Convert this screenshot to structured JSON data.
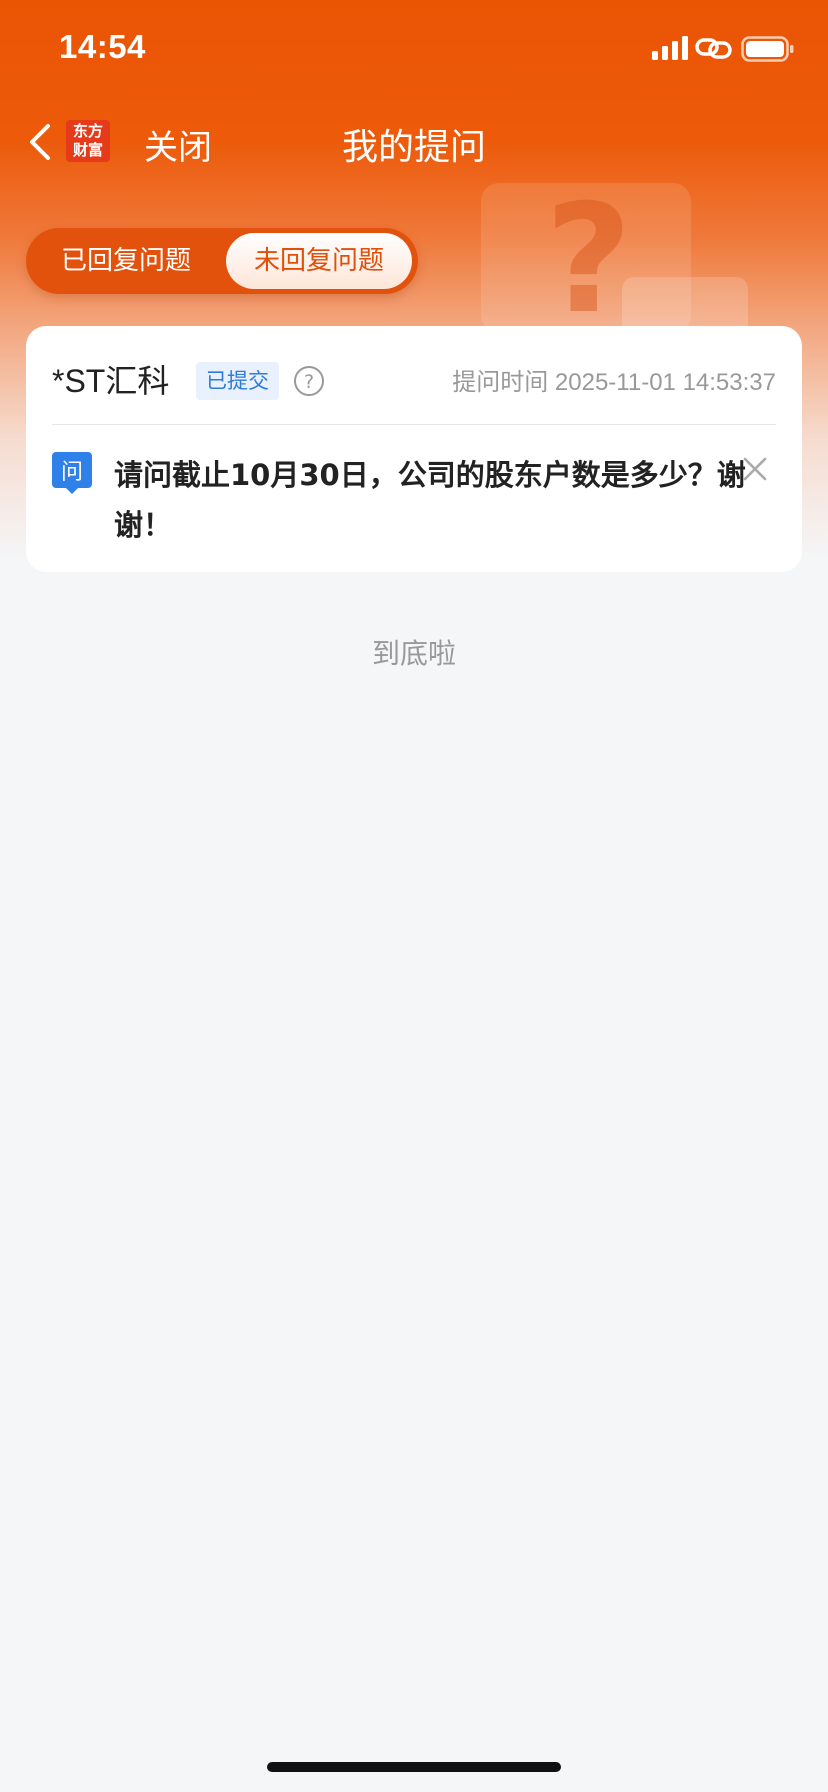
{
  "status_bar": {
    "time": "14:54",
    "icons": [
      "signal-icon",
      "link-icon",
      "battery-icon"
    ]
  },
  "nav": {
    "logo_text": "东方财富",
    "logo_line1": "东方",
    "logo_line2": "财富",
    "close_label": "关闭",
    "title": "我的提问"
  },
  "tabs": {
    "replied_label": "已回复问题",
    "unreplied_label": "未回复问题",
    "active": "unreplied"
  },
  "question_card": {
    "stock_name": "*ST汇科",
    "status": "已提交",
    "ask_time": "提问时间 2025-11-01 14:53:37",
    "q_icon_label": "问",
    "question": "请问截止10月30日，公司的股东户数是多少？谢谢！"
  },
  "end_text": "到底啦",
  "colors": {
    "brand_orange": "#ea5504",
    "badge_blue": "#2e7bdc",
    "badge_bg": "#e8f1fd",
    "q_icon_blue": "#2f80e8"
  }
}
